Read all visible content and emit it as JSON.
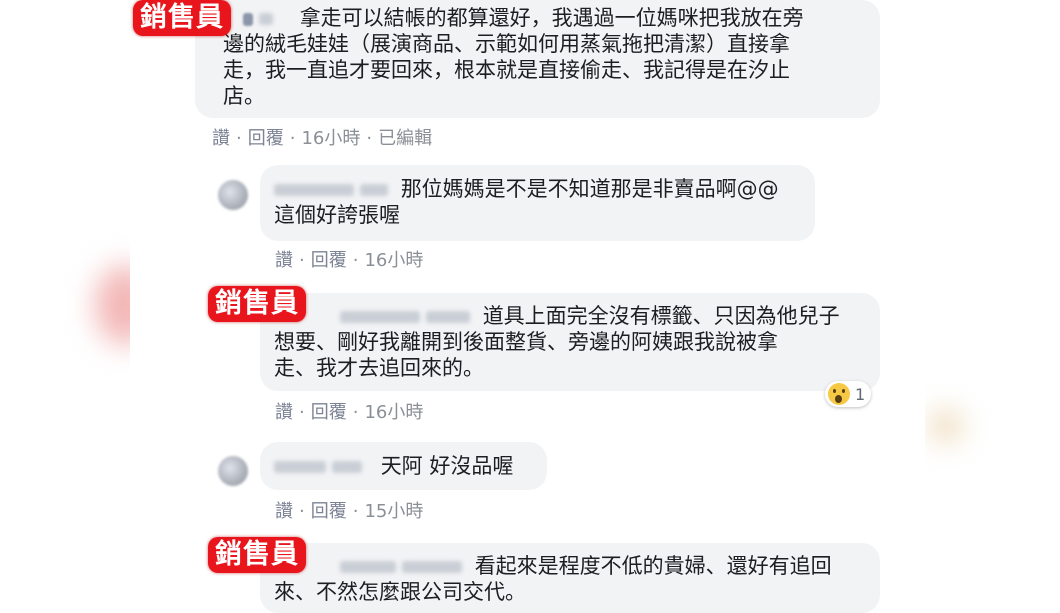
{
  "tag_label": "銷售員",
  "comments": [
    {
      "text": "拿走可以結帳的都算還好，我遇過一位媽咪把我放在旁邊的絨毛娃娃（展演商品、示範如何用蒸氣拖把清潔）直接拿走，我一直追才要回來，根本就是直接偷走、我記得是在汐止店。",
      "line1": "拿走可以結帳的都算還好，我遇過一位媽咪把我放在旁",
      "line2": "邊的絨毛娃娃（展演商品、示範如何用蒸氣拖把清潔）直接拿",
      "line3": "走，我一直追才要回來，根本就是直接偷走、我記得是在汐止",
      "line4": "店。",
      "like": "讚",
      "reply": "回覆",
      "time": "16小時",
      "edited": "已編輯"
    },
    {
      "line1": "那位媽媽是不是不知道那是非賣品啊@@",
      "line2": "這個好誇張喔",
      "like": "讚",
      "reply": "回覆",
      "time": "16小時"
    },
    {
      "line1": "道具上面完全沒有標籤、只因為他兒子",
      "line2": "想要、剛好我離開到後面整貨、旁邊的阿姨跟我說被拿",
      "line3": "走、我才去追回來的。",
      "reaction_count": "1",
      "like": "讚",
      "reply": "回覆",
      "time": "16小時"
    },
    {
      "line1": "天阿 好沒品喔",
      "like": "讚",
      "reply": "回覆",
      "time": "15小時"
    },
    {
      "line1": "看起來是程度不低的貴婦、還好有追回",
      "line2": "來、不然怎麼跟公司交代。"
    }
  ],
  "colors": {
    "tag": "#e8161c",
    "bubble": "#f2f3f5",
    "meta": "#8b8f96"
  }
}
